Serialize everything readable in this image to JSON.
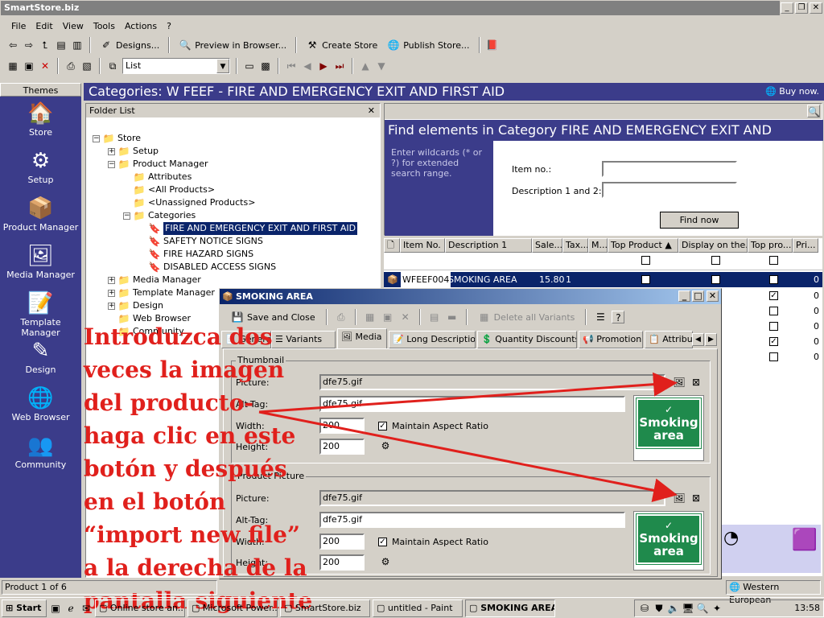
{
  "window": {
    "title": "SmartStore.biz",
    "controls": [
      "_",
      "❐",
      "✕"
    ]
  },
  "menu": [
    "File",
    "Edit",
    "View",
    "Tools",
    "Actions",
    "?"
  ],
  "toolbar1": {
    "designs": "Designs...",
    "preview": "Preview in Browser...",
    "create": "Create Store",
    "publish": "Publish Store..."
  },
  "toolbar2": {
    "view_select": "List"
  },
  "sidebar": {
    "header": "Themes",
    "items": [
      {
        "label": "Store",
        "icon": "store-icon",
        "glyph": "🏠"
      },
      {
        "label": "Setup",
        "icon": "setup-icon",
        "glyph": "⚙"
      },
      {
        "label": "Product Manager",
        "icon": "product-manager-icon",
        "glyph": "📦"
      },
      {
        "label": "Media Manager",
        "icon": "media-manager-icon",
        "glyph": "🖼"
      },
      {
        "label": "Template Manager",
        "icon": "template-manager-icon",
        "glyph": "📝"
      },
      {
        "label": "Design",
        "icon": "design-icon",
        "glyph": "✎"
      },
      {
        "label": "Web Browser",
        "icon": "web-browser-icon",
        "glyph": "🌐"
      },
      {
        "label": "Community",
        "icon": "community-icon",
        "glyph": "👥"
      }
    ]
  },
  "header": {
    "title": "Categories: W FEEF - FIRE AND EMERGENCY EXIT AND FIRST AID",
    "buy_now": "Buy now."
  },
  "folder_list": {
    "title": "Folder List",
    "nodes": [
      {
        "label": "Store",
        "level": 0,
        "expander": "−"
      },
      {
        "label": "Setup",
        "level": 1,
        "expander": "+"
      },
      {
        "label": "Product Manager",
        "level": 1,
        "expander": "−"
      },
      {
        "label": "Attributes",
        "level": 2,
        "expander": ""
      },
      {
        "label": "<All Products>",
        "level": 2,
        "expander": ""
      },
      {
        "label": "<Unassigned Products>",
        "level": 2,
        "expander": ""
      },
      {
        "label": "Categories",
        "level": 2,
        "expander": "−"
      },
      {
        "label": "FIRE AND EMERGENCY EXIT AND FIRST AID",
        "level": 3,
        "expander": "",
        "selected": true
      },
      {
        "label": "SAFETY NOTICE SIGNS",
        "level": 3,
        "expander": ""
      },
      {
        "label": "FIRE HAZARD SIGNS",
        "level": 3,
        "expander": ""
      },
      {
        "label": "DISABLED ACCESS SIGNS",
        "level": 3,
        "expander": ""
      },
      {
        "label": "Media Manager",
        "level": 1,
        "expander": "+"
      },
      {
        "label": "Template Manager",
        "level": 1,
        "expander": "+"
      },
      {
        "label": "Design",
        "level": 1,
        "expander": "+"
      },
      {
        "label": "Web Browser",
        "level": 1,
        "expander": ""
      },
      {
        "label": "Community",
        "level": 1,
        "expander": ""
      }
    ]
  },
  "find": {
    "title": "Find elements in Category FIRE AND EMERGENCY EXIT AND",
    "hint": "Enter wildcards (* or ?) for extended search range.",
    "item_no_label": "Item no.:",
    "item_no_value": "",
    "desc_label": "Description 1 and 2:",
    "desc_value": "",
    "button": "Find now"
  },
  "grid": {
    "columns": [
      "Item No.",
      "Description 1",
      "Sale...",
      "Tax...",
      "M...",
      "Top Product ▲",
      "Display on the...",
      "Top pro...",
      "Pri..."
    ],
    "row": {
      "item_no": "WFEEF004",
      "desc": "SMOKING AREA",
      "sale": "15.80",
      "tax": "1",
      "price": "0"
    },
    "extra_prices": [
      "0",
      "0",
      "0",
      "0",
      "0"
    ]
  },
  "dialog": {
    "title": "SMOKING AREA",
    "save_close": "Save and Close",
    "delete_variants": "Delete all Variants",
    "tabs": [
      "General",
      "Variants",
      "Media",
      "Long Description",
      "Quantity Discounts",
      "Promotion",
      "Attribu"
    ],
    "thumbnail": {
      "group": "Thumbnail",
      "picture_label": "Picture:",
      "picture": "dfe75.gif",
      "alt_label": "Alt-Tag:",
      "alt": "dfe75.gif",
      "width_label": "Width:",
      "width": "200",
      "height_label": "Height:",
      "height": "200",
      "aspect": "Maintain Aspect Ratio"
    },
    "product_picture": {
      "group": "Product Picture",
      "picture_label": "Picture:",
      "picture": "dfe75.gif",
      "alt_label": "Alt-Tag:",
      "alt": "dfe75.gif",
      "width_label": "Width:",
      "width": "200",
      "height_label": "Height:",
      "height": "200",
      "aspect": "Maintain Aspect Ratio"
    },
    "sign_text": [
      "Smoking",
      "area"
    ]
  },
  "status": {
    "left": "Product 1 of 6",
    "language": "Western European"
  },
  "taskbar": {
    "start": "Start",
    "tasks": [
      "Online store an...",
      "Microsoft Power...",
      "SmartStore.biz",
      "untitled - Paint",
      "SMOKING AREA"
    ],
    "clock": "13:58"
  },
  "overlay_lines": [
    "Introduzca dos",
    "veces la imagen",
    "del producto-",
    "haga clic en este",
    "botón y después",
    "en el botón",
    "“import new file”",
    "a la derecha de la",
    "pantalla siguiente"
  ],
  "colors": {
    "brand_blue": "#3b3c8a",
    "selection": "#0a246a",
    "overlay_red": "#e0201c",
    "sign_green": "#1f8a4c"
  }
}
